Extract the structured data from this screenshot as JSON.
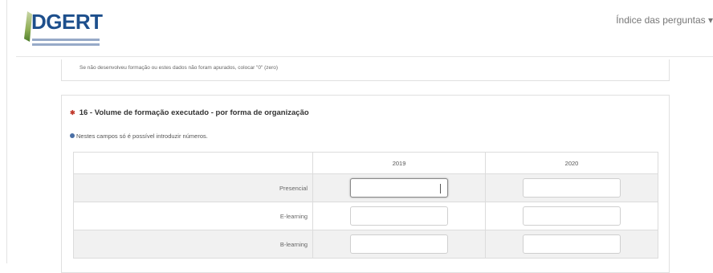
{
  "header": {
    "logo_text": "DGERT",
    "nav_label": "Índice das perguntas ▾"
  },
  "previous_question": {
    "note": "Se não desenvolveu formação ou estes dados não foram apurados, colocar \"0\" (zero)"
  },
  "question": {
    "required_marker": "✱",
    "title": "16 - Volume de formação executado - por forma de organização",
    "hint": "Nestes campos só é possível introduzir números.",
    "columns": [
      "2019",
      "2020"
    ],
    "rows": [
      {
        "label": "Presencial",
        "v2019": "",
        "v2020": ""
      },
      {
        "label": "E-learning",
        "v2019": "",
        "v2020": ""
      },
      {
        "label": "B-learning",
        "v2019": "",
        "v2020": ""
      }
    ]
  }
}
